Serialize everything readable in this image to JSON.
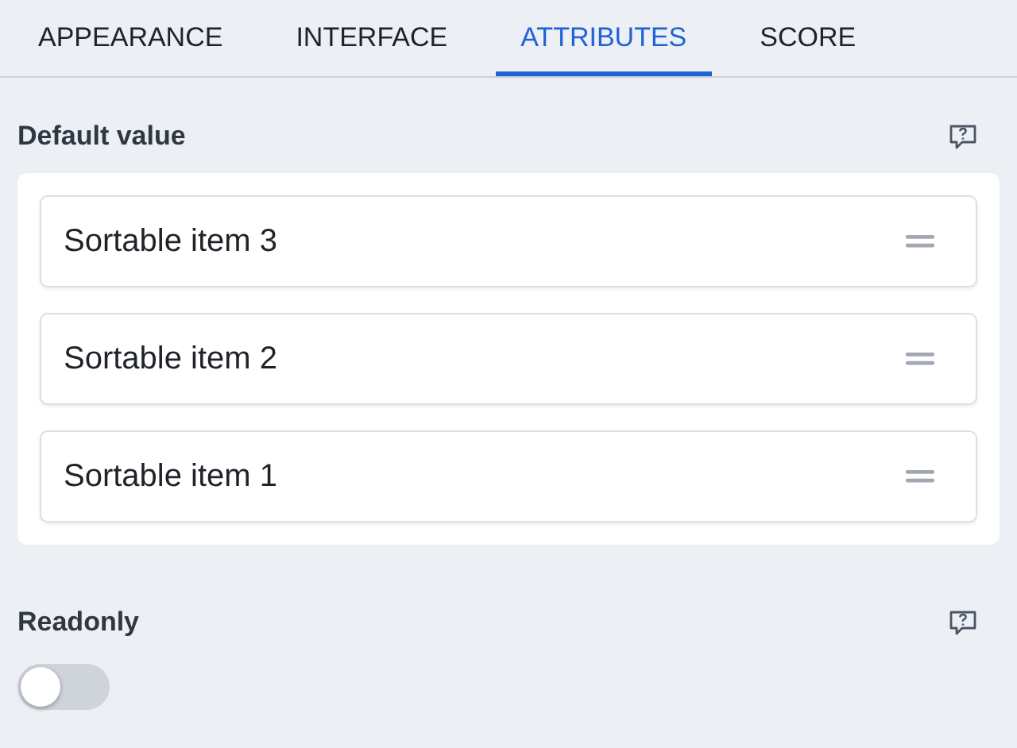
{
  "tabs": [
    {
      "label": "APPEARANCE",
      "selected": false
    },
    {
      "label": "INTERFACE",
      "selected": false
    },
    {
      "label": "ATTRIBUTES",
      "selected": true
    },
    {
      "label": "SCORE",
      "selected": false
    }
  ],
  "default_value": {
    "label": "Default value",
    "items": [
      {
        "label": "Sortable item 3"
      },
      {
        "label": "Sortable item 2"
      },
      {
        "label": "Sortable item 1"
      }
    ]
  },
  "readonly": {
    "label": "Readonly",
    "on": false
  }
}
